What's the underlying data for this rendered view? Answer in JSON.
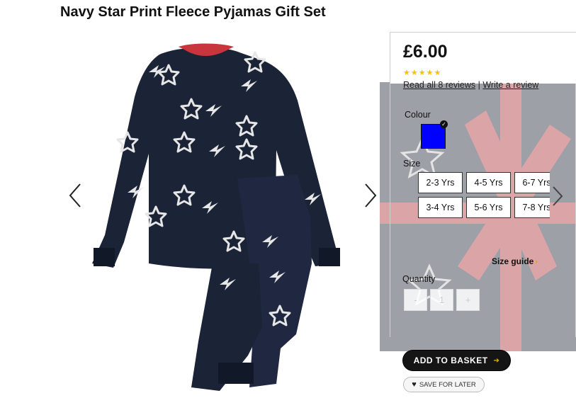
{
  "product": {
    "title": "Navy Star Print Fleece Pyjamas Gift Set",
    "price": "£6.00",
    "rating_stars": "★★★★★",
    "rating": 5,
    "reviews_link": "Read all 8 reviews",
    "separator": "|",
    "write_review": "Write a review"
  },
  "carousel": {
    "prev_icon": "chevron-left-icon",
    "next_icon": "chevron-right-icon"
  },
  "colour": {
    "label": "Colour",
    "selected_color": "#0000ff"
  },
  "size": {
    "label": "Size",
    "options": [
      "2-3 Yrs",
      "4-5 Yrs",
      "6-7 Yrs",
      "3-4 Yrs",
      "5-6 Yrs",
      "7-8 Yrs"
    ],
    "guide": "Size guide"
  },
  "quantity": {
    "label": "Quantity",
    "minus": "-",
    "value": "1",
    "plus": "+"
  },
  "actions": {
    "add_to_basket": "ADD TO BASKET",
    "save_for_later": "SAVE FOR LATER"
  },
  "colors": {
    "navy": "#1b2337",
    "accent": "#f0b400",
    "gift_ribbon": "#c8353d"
  }
}
